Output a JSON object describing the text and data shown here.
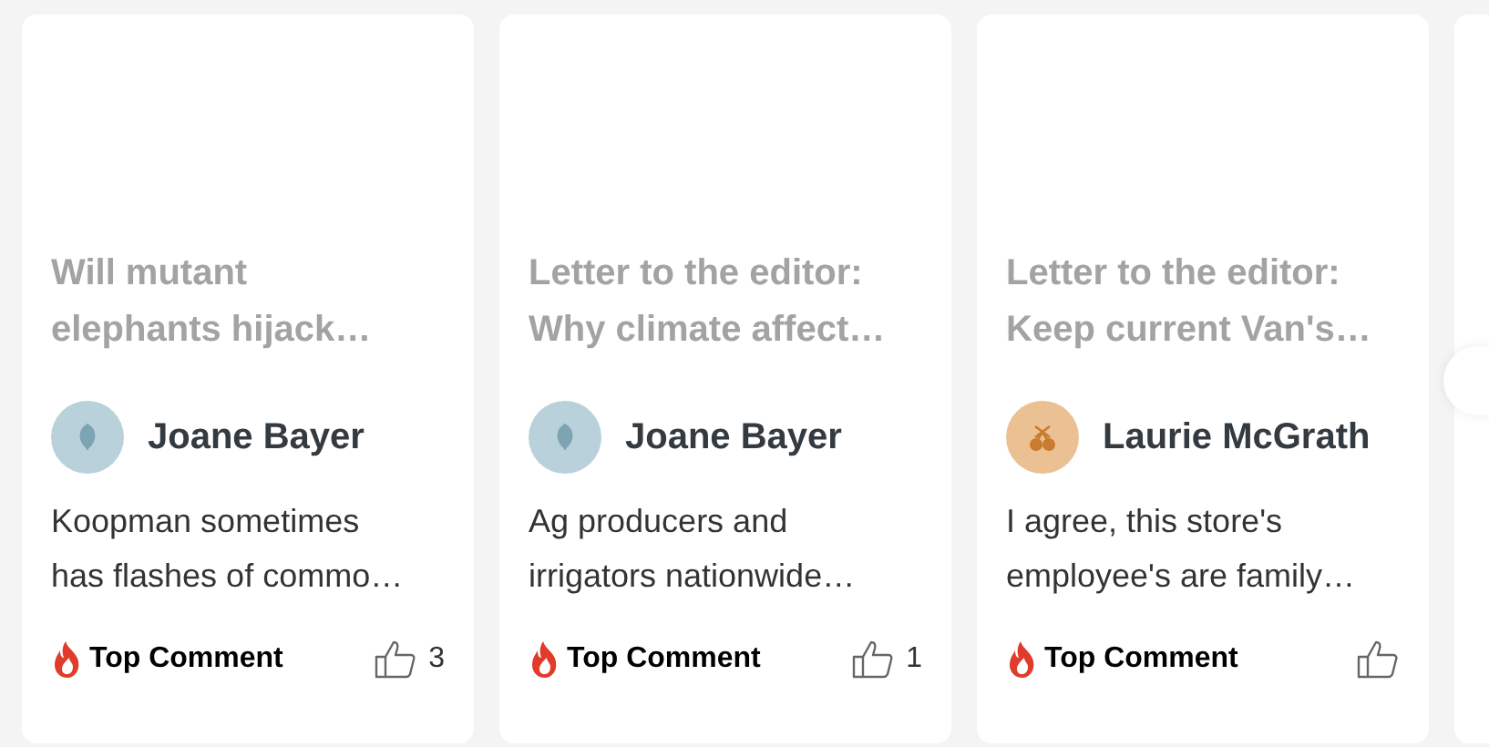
{
  "cards": [
    {
      "title": "Will mutant elephants hijack…",
      "author": "Joane Bayer",
      "avatar": {
        "kind": "leaf",
        "color": "#b9d1da"
      },
      "comment": "Koopman sometimes has flashes of commo…",
      "badge": "Top Comment",
      "likes": "3"
    },
    {
      "title": "Letter to the editor: Why climate affect…",
      "author": "Joane Bayer",
      "avatar": {
        "kind": "leaf",
        "color": "#b9d1da"
      },
      "comment": "Ag producers and irrigators nationwide…",
      "badge": "Top Comment",
      "likes": "1"
    },
    {
      "title": "Letter to the editor: Keep current Van's…",
      "author": "Laurie McGrath",
      "avatar": {
        "kind": "cherry",
        "color": "#ebc194"
      },
      "comment": "I agree, this store's employee's are family…",
      "badge": "Top Comment"
    }
  ]
}
